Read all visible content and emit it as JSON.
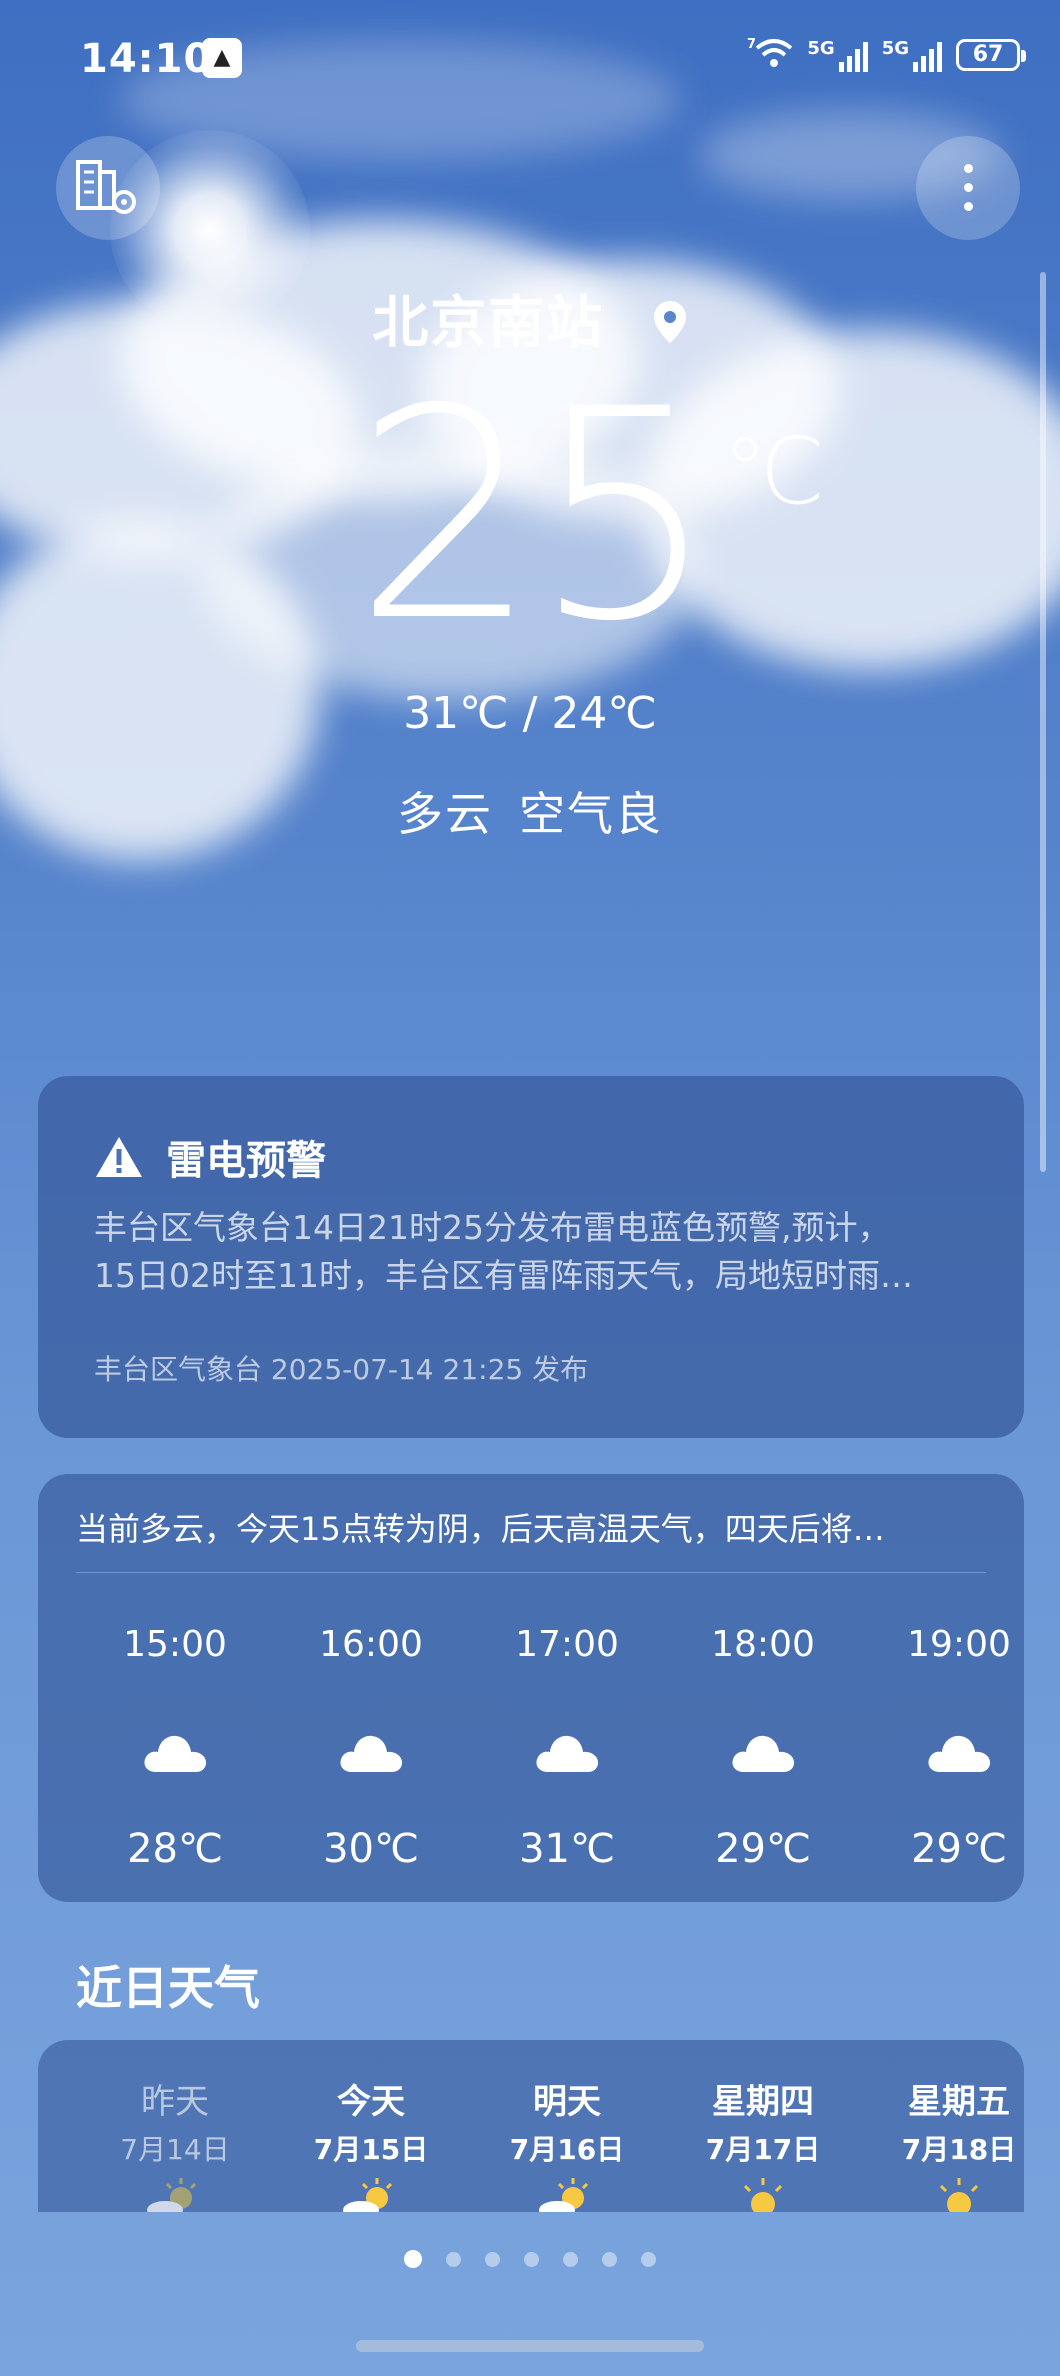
{
  "status_bar": {
    "time": "14:10",
    "battery": "67",
    "network1": "5G",
    "network2": "5G",
    "wifi_badge": "7"
  },
  "location": {
    "name": "北京南站"
  },
  "current": {
    "temperature": "25",
    "unit": "℃",
    "range": "31℃ / 24℃",
    "condition": "多云",
    "air": "空气良"
  },
  "alert": {
    "title": "雷电预警",
    "line1": "丰台区气象台14日21时25分发布雷电蓝色预警,预计，",
    "line2": "15日02时至11时，丰台区有雷阵雨天气，局地短时雨…",
    "source": "丰台区气象台 2025-07-14 21:25 发布"
  },
  "hourly": {
    "summary": "当前多云，今天15点转为阴，后天高温天气，四天后将…",
    "items": [
      {
        "time": "15:00",
        "icon": "cloud-icon",
        "temp": "28℃"
      },
      {
        "time": "16:00",
        "icon": "cloud-icon",
        "temp": "30℃"
      },
      {
        "time": "17:00",
        "icon": "cloud-icon",
        "temp": "31℃"
      },
      {
        "time": "18:00",
        "icon": "cloud-icon",
        "temp": "29℃"
      },
      {
        "time": "19:00",
        "icon": "cloud-icon",
        "temp": "29℃"
      }
    ]
  },
  "daily": {
    "title": "近日天气",
    "items": [
      {
        "day": "昨天",
        "date": "7月14日",
        "icon": "partly-cloudy-icon"
      },
      {
        "day": "今天",
        "date": "7月15日",
        "icon": "partly-cloudy-icon"
      },
      {
        "day": "明天",
        "date": "7月16日",
        "icon": "partly-cloudy-icon"
      },
      {
        "day": "星期四",
        "date": "7月17日",
        "icon": "sun-icon"
      },
      {
        "day": "星期五",
        "date": "7月18日",
        "icon": "sun-icon"
      }
    ]
  },
  "pager": {
    "count": 7,
    "active": 0
  },
  "colors": {
    "sky_top": "#3f6fc2",
    "sky_bottom": "#7aa4dd",
    "sun": "#f7c842"
  }
}
